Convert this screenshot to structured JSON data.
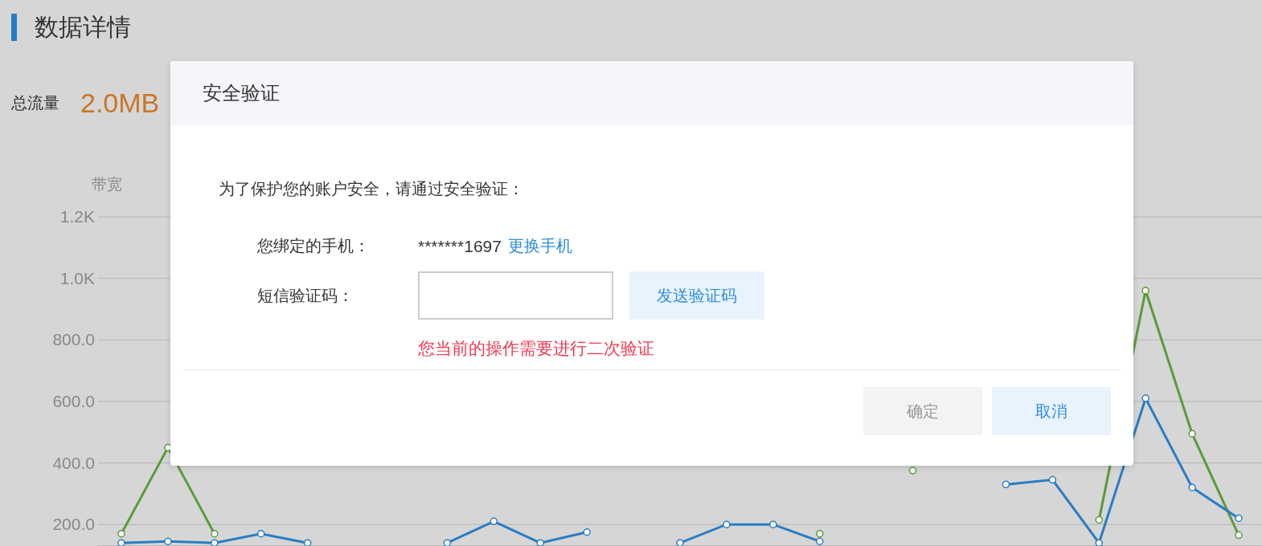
{
  "page": {
    "title": "数据详情",
    "total": {
      "label": "总流量",
      "value": "2.0MB"
    }
  },
  "chart": {
    "chart_data": {
      "type": "line",
      "ylabel": "带宽",
      "grid": true,
      "ylim": [
        130,
        1200
      ],
      "categories": [
        null,
        null,
        null,
        null,
        null,
        null,
        null,
        null,
        null,
        null,
        null,
        null,
        null,
        null,
        null,
        null,
        null,
        null,
        null,
        null,
        null,
        null,
        null,
        null,
        null
      ],
      "yticks": [
        {
          "value": 1200,
          "label": "1.2K"
        },
        {
          "value": 1000,
          "label": "1.0K"
        },
        {
          "value": 800,
          "label": "800.0"
        },
        {
          "value": 600,
          "label": "600.0"
        },
        {
          "value": 400,
          "label": "400.0"
        },
        {
          "value": 200,
          "label": "200.0"
        }
      ],
      "series": [
        {
          "color": "#5a9b3a",
          "marker": "circle",
          "values": [
            170,
            450,
            170,
            null,
            null,
            null,
            null,
            null,
            null,
            null,
            null,
            null,
            null,
            null,
            null,
            170,
            null,
            375,
            null,
            null,
            null,
            215,
            960,
            495,
            165
          ]
        },
        {
          "color": "#2a7cc4",
          "marker": "circle",
          "values": [
            140,
            145,
            140,
            170,
            140,
            null,
            null,
            140,
            210,
            140,
            175,
            null,
            140,
            200,
            200,
            145,
            null,
            null,
            null,
            330,
            345,
            140,
            610,
            320,
            220
          ]
        }
      ]
    }
  },
  "dialog": {
    "title": "安全验证",
    "message": "为了保护您的账户安全，请通过安全验证：",
    "phone": {
      "label": "您绑定的手机：",
      "value": "*******1697",
      "link": "更换手机"
    },
    "code": {
      "label": "短信验证码：",
      "send_button": "发送验证码"
    },
    "error": "您当前的操作需要进行二次验证",
    "buttons": [
      {
        "label": "确定",
        "disabled": true
      },
      {
        "label": "取消",
        "disabled": false
      }
    ]
  }
}
